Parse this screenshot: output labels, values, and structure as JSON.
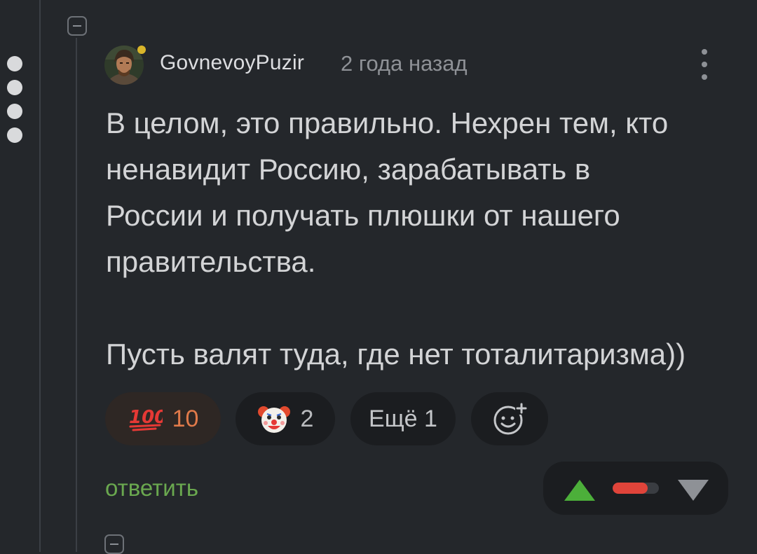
{
  "comment": {
    "author": "GovnevoyPuzir",
    "timestamp": "2 года назад",
    "body_lines": [
      "В целом, это правильно. Нехрен тем, кто",
      "ненавидит Россию, зарабатывать в",
      "России и получать плюшки от нашего",
      "правительства.",
      "",
      "Пусть валят туда, где нет тоталитаризма))"
    ],
    "reactions": [
      {
        "icon": "hundred-points-emoji",
        "emoji": "💯",
        "count": "10"
      },
      {
        "icon": "clown-face-emoji",
        "emoji": "🤡",
        "count": "2"
      }
    ],
    "more_reactions_label": "Ещё 1",
    "add_reaction_icon": "smiley-plus-icon",
    "reply_label": "ответить",
    "vote": {
      "down_share": 0.75,
      "up_color": "#4caf3a",
      "down_color": "#e0443a"
    }
  },
  "thread": {
    "depth_dots": 4
  },
  "colors": {
    "background": "#24272b",
    "reply_link": "#6aa84f",
    "online_indicator": "#d9b52a",
    "highlighted_count": "#e07a4a"
  }
}
